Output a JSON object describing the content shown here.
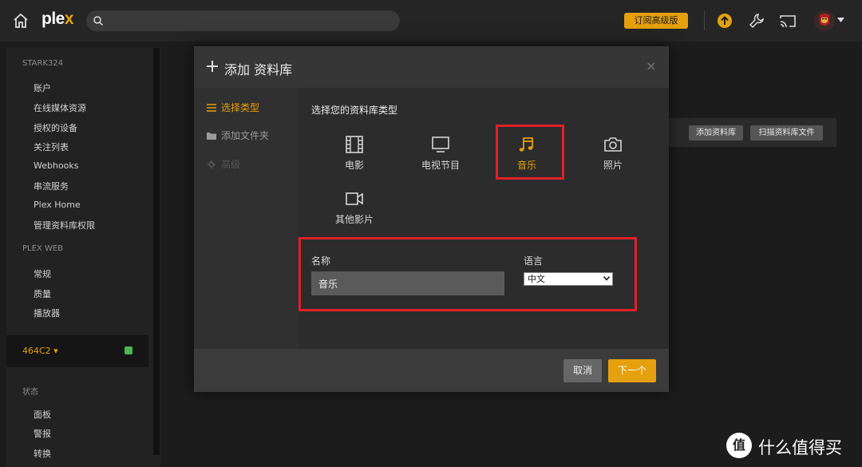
{
  "header": {
    "logo_main": "ple",
    "logo_x": "x",
    "search_placeholder": "",
    "upgrade_label": "订阅高级版"
  },
  "sidebar": {
    "account_heading": "STARK324",
    "account_items": [
      "账户",
      "在线媒体资源",
      "授权的设备",
      "关注列表",
      "Webhooks",
      "串流服务",
      "Plex Home",
      "管理资料库权限"
    ],
    "web_heading": "PLEX WEB",
    "web_items": [
      "常规",
      "质量",
      "播放器"
    ],
    "server_name": "464C2 ▾",
    "status_heading": "状态",
    "status_items": [
      "面板",
      "警报",
      "转换"
    ]
  },
  "background": {
    "add_library_label": "添加资料库",
    "scan_library_label": "扫描资料库文件"
  },
  "modal": {
    "title": "添加 资料库",
    "close": "×",
    "steps": [
      {
        "label": "选择类型",
        "active": true
      },
      {
        "label": "添加文件夹",
        "active": false
      },
      {
        "label": "高级",
        "active": false
      }
    ],
    "prompt": "选择您的资料库类型",
    "types": [
      {
        "label": "电影",
        "icon": "film-icon",
        "selected": false
      },
      {
        "label": "电视节目",
        "icon": "tv-icon",
        "selected": false
      },
      {
        "label": "音乐",
        "icon": "music-note-icon",
        "selected": true
      },
      {
        "label": "照片",
        "icon": "camera-icon",
        "selected": false
      },
      {
        "label": "其他影片",
        "icon": "video-camera-icon",
        "selected": false
      }
    ],
    "name_label": "名称",
    "name_value": "音乐",
    "language_label": "语言",
    "language_value": "中文",
    "cancel_label": "取消",
    "next_label": "下一个"
  },
  "watermark": {
    "glyph": "值",
    "text": "什么值得买"
  },
  "colors": {
    "accent": "#e5a00d",
    "highlight_box": "#e0202a"
  }
}
